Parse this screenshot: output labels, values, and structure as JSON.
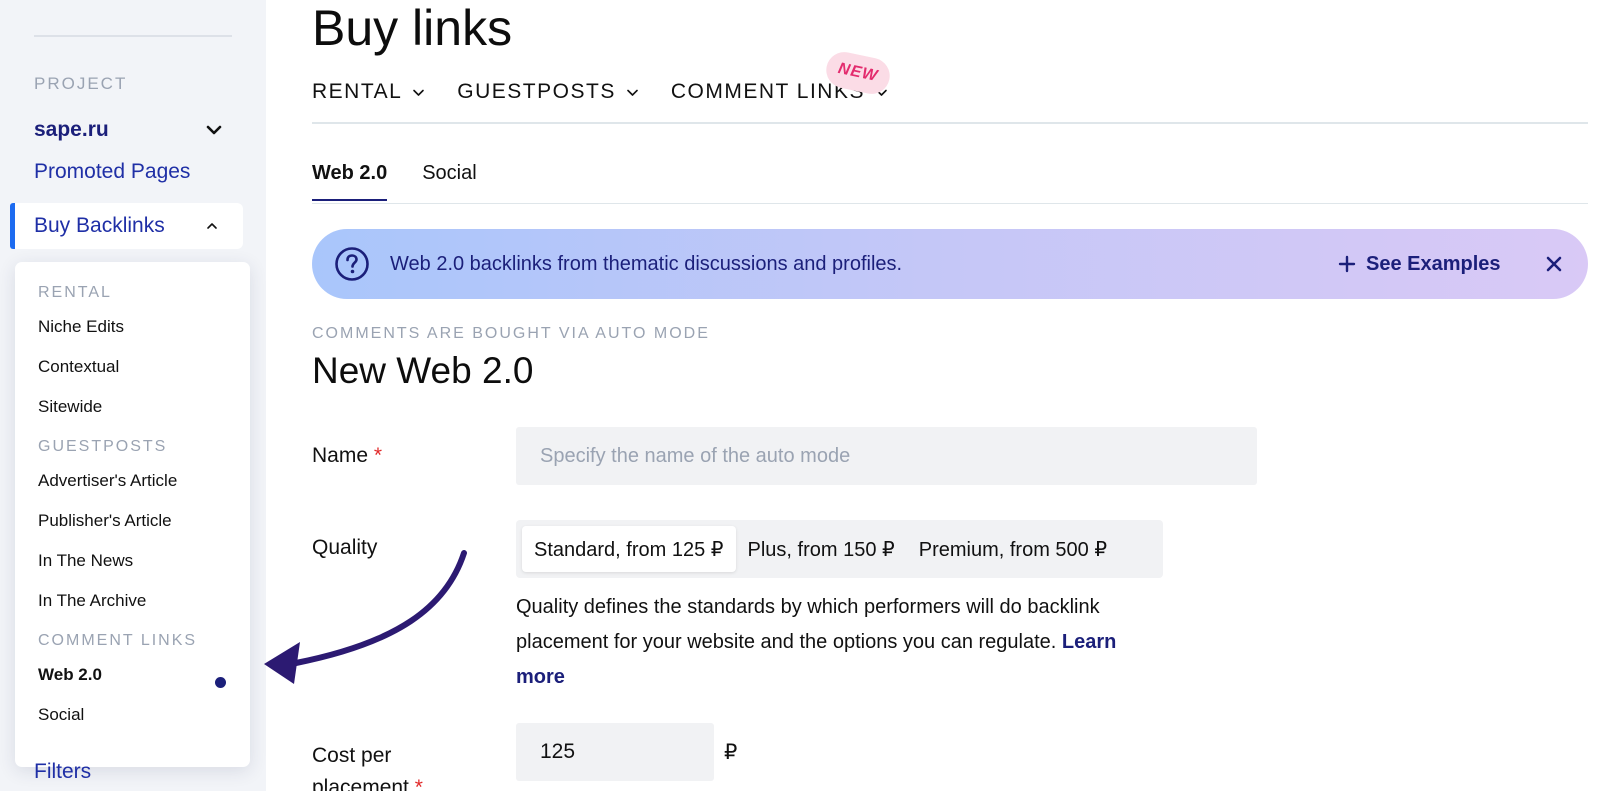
{
  "sidebar": {
    "project_label": "PROJECT",
    "project_name": "sape.ru",
    "promoted_pages": "Promoted Pages",
    "buy_backlinks": "Buy Backlinks",
    "filters": "Filters",
    "accent_color": "#1d6bf0"
  },
  "menu": {
    "sections": [
      {
        "label": "RENTAL",
        "items": [
          "Niche Edits",
          "Contextual",
          "Sitewide"
        ]
      },
      {
        "label": "GUESTPOSTS",
        "items": [
          "Advertiser's Article",
          "Publisher's Article",
          "In The News",
          "In The Archive"
        ]
      },
      {
        "label": "COMMENT LINKS",
        "items": [
          "Web 2.0",
          "Social"
        ]
      }
    ],
    "active_item": "Web 2.0"
  },
  "page": {
    "title": "Buy links",
    "nav": [
      "RENTAL",
      "GUESTPOSTS",
      "COMMENT LINKS"
    ],
    "new_badge": "NEW",
    "tabs": [
      "Web 2.0",
      "Social"
    ],
    "active_tab": "Web 2.0"
  },
  "banner": {
    "text": "Web 2.0 backlinks from thematic discussions and profiles.",
    "action": "See Examples"
  },
  "form": {
    "mode_label": "COMMENTS ARE BOUGHT VIA AUTO MODE",
    "title": "New Web 2.0",
    "name_label": "Name",
    "name_placeholder": "Specify the name of the auto mode",
    "quality_label": "Quality",
    "quality_options": [
      "Standard, from 125 ₽",
      "Plus, from 150 ₽",
      "Premium, from 500 ₽"
    ],
    "quality_selected": "Standard, from 125 ₽",
    "quality_help": "Quality defines the standards by which performers will do backlink placement for your website and the options you can regulate.",
    "learn_more": "Learn more",
    "cost_label_line1": "Cost per",
    "cost_label_line2": "placement",
    "cost_value": "125",
    "currency": "₽",
    "required_mark": "*"
  }
}
